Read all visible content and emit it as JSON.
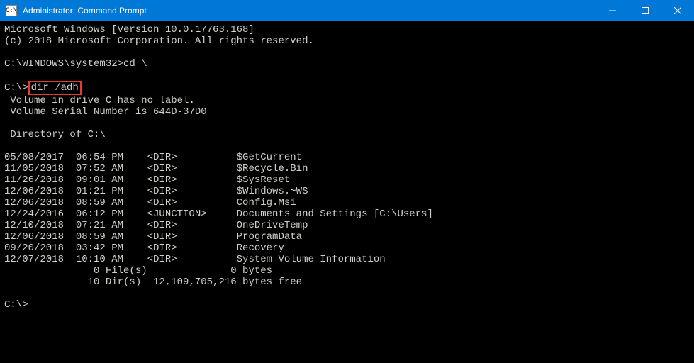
{
  "window": {
    "title": "Administrator: Command Prompt",
    "icon_label": "C:\\"
  },
  "os_header": {
    "line1": "Microsoft Windows [Version 10.0.17763.168]",
    "line2": "(c) 2018 Microsoft Corporation. All rights reserved."
  },
  "prompt1": {
    "prompt": "C:\\WINDOWS\\system32>",
    "command": "cd \\"
  },
  "prompt2": {
    "prompt": "C:\\>",
    "command": "dir /adh"
  },
  "volume": {
    "line1": " Volume in drive C has no label.",
    "line2": " Volume Serial Number is 644D-37D0"
  },
  "dir_header": " Directory of C:\\",
  "entries": [
    {
      "date": "05/08/2017",
      "time": "06:54 PM",
      "type": "<DIR>",
      "name": "$GetCurrent"
    },
    {
      "date": "11/05/2018",
      "time": "07:52 AM",
      "type": "<DIR>",
      "name": "$Recycle.Bin"
    },
    {
      "date": "11/26/2018",
      "time": "09:01 AM",
      "type": "<DIR>",
      "name": "$SysReset"
    },
    {
      "date": "12/06/2018",
      "time": "01:21 PM",
      "type": "<DIR>",
      "name": "$Windows.~WS"
    },
    {
      "date": "12/06/2018",
      "time": "08:59 AM",
      "type": "<DIR>",
      "name": "Config.Msi"
    },
    {
      "date": "12/24/2016",
      "time": "06:12 PM",
      "type": "<JUNCTION>",
      "name": "Documents and Settings [C:\\Users]"
    },
    {
      "date": "12/10/2018",
      "time": "07:21 AM",
      "type": "<DIR>",
      "name": "OneDriveTemp"
    },
    {
      "date": "12/06/2018",
      "time": "08:59 AM",
      "type": "<DIR>",
      "name": "ProgramData"
    },
    {
      "date": "09/20/2018",
      "time": "03:42 PM",
      "type": "<DIR>",
      "name": "Recovery"
    },
    {
      "date": "12/07/2018",
      "time": "10:10 AM",
      "type": "<DIR>",
      "name": "System Volume Information"
    }
  ],
  "summary": {
    "files": "               0 File(s)              0 bytes",
    "dirs": "              10 Dir(s)  12,109,705,216 bytes free"
  },
  "prompt3": {
    "prompt": "C:\\>",
    "cursor": ""
  }
}
